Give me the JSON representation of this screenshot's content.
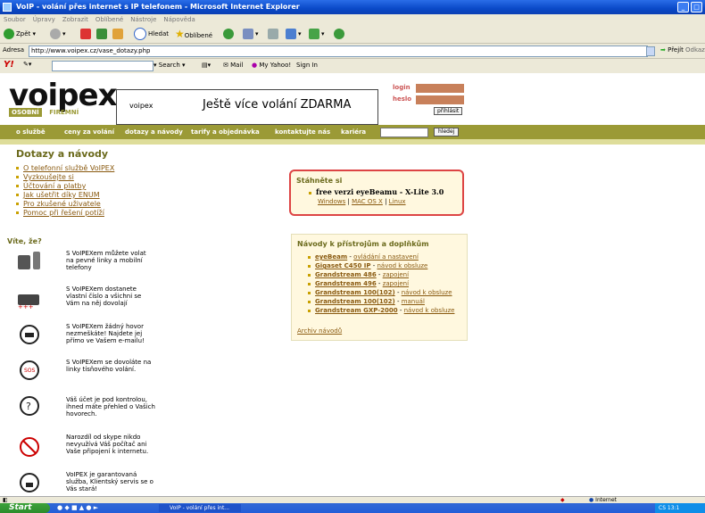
{
  "window": {
    "title": "VoIP - volání přes internet s IP telefonem - Microsoft Internet Explorer"
  },
  "menu": [
    "Soubor",
    "Úpravy",
    "Zobrazit",
    "Oblíbené",
    "Nástroje",
    "Nápověda"
  ],
  "toolbar": {
    "back": "Zpět",
    "search": "Hledat",
    "favorites": "Oblíbené"
  },
  "address": {
    "label": "Adresa",
    "url": "http://www.voipex.cz/vase_dotazy.php",
    "go": "Přejít",
    "links": "Odkazy"
  },
  "yahoo": {
    "search": "Search",
    "mail": "Mail",
    "myyahoo": "My Yahoo!",
    "signin": "Sign In"
  },
  "site": {
    "logo": "voipex",
    "banner_small": "voipex",
    "banner_text": "Ještě více volání ZDARMA",
    "login_label": "login",
    "password_label": "heslo",
    "login_button": "přihlásit",
    "tab_personal": "OSOBNÍ",
    "tab_business": "FIREMNÍ",
    "nav": [
      "o službě",
      "ceny za volání",
      "dotazy a návody",
      "tarify a objednávka",
      "kontaktujte nás",
      "kariéra"
    ],
    "search_button": "hledej"
  },
  "faq": {
    "title": "Dotazy a návody",
    "items": [
      "O telefonní službě VoIPEX",
      "Vyzkoušejte si",
      "Účtování a platby",
      "Jak ušetřit díky ENUM",
      "Pro zkušené uživatele",
      "Pomoc při řešení potíží"
    ]
  },
  "download": {
    "title": "Stáhněte si",
    "item": "free verzi eyeBeamu - X-Lite 3.0",
    "links": [
      "Windows",
      "MAC OS X",
      "Linux"
    ]
  },
  "guides": {
    "title": "Návody k přístrojům a doplňkům",
    "items": [
      {
        "name": "eyeBeam",
        "desc": "ovládání a nastavení"
      },
      {
        "name": "Gigaset C450 IP",
        "desc": "návod k obsluze"
      },
      {
        "name": "Grandstream 486",
        "desc": "zapojení"
      },
      {
        "name": "Grandstream 496",
        "desc": "zapojení"
      },
      {
        "name": "Grandstream 100(102)",
        "desc": "návod k obsluze"
      },
      {
        "name": "Grandstream 100(102)",
        "desc": "manuál"
      },
      {
        "name": "Grandstream GXP-2000",
        "desc": "návod k obsluze"
      }
    ],
    "archive": "Archiv návodů"
  },
  "didyouknow": {
    "title": "Víte, že?",
    "items": [
      "S VoIPEXem můžete volat na pevné linky a mobilní telefony",
      "S VoIPEXem dostanete vlastní číslo a všichni se Vám na něj dovolají",
      "S VoIPEXem žádný hovor nezmeškáte! Najdete jej přímo ve Vašem e-mailu!",
      "S VoIPEXem se dovoláte na linky tísňového volání.",
      "Váš účet je pod kontrolou, ihned máte přehled o Vašich hovorech.",
      "Narozdíl od skype nikdo nevyužívá Váš počítač ani Vaše připojení k internetu.",
      "VoIPEX je garantovaná služba, Klientský servis se o Vás stará!"
    ]
  },
  "statusbar": {
    "zone": "Internet"
  },
  "taskbar": {
    "start": "Start",
    "task": "VoIP - volání přes int...",
    "tray": "CS 13:1"
  },
  "colors": {
    "nav": "#9b9a36",
    "heading": "#6b6a1c",
    "link": "#8a5a10",
    "box_border": "#d44",
    "box_bg": "#fff8df"
  }
}
